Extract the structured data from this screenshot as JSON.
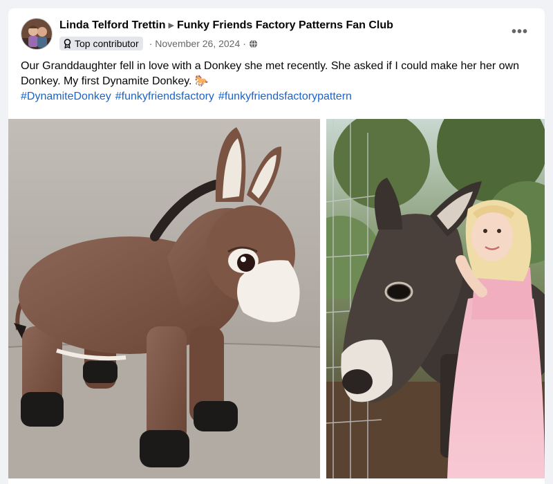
{
  "post": {
    "author": "Linda Telford Trettin",
    "group": "Funky Friends Factory Patterns Fan Club",
    "badge": "Top contributor",
    "date": "November 26, 2024",
    "more": "•••",
    "text": "Our Granddaughter fell in love with a Donkey she met recently. She asked if I could make her her own Donkey. My first Dynamite Donkey. 🐎",
    "hashtags": [
      "#DynamiteDonkey",
      "#funkyfriendsfactory",
      "#funkyfriendsfactorypattern"
    ]
  },
  "icons": {
    "badge_icon": "award-icon",
    "privacy_icon": "globe-icon",
    "separator_icon": "triangle-right-icon",
    "menu_icon": "more-options-icon"
  },
  "colors": {
    "link": "#1b63c6",
    "secondary_text": "#65676b",
    "badge_bg": "#e4e6eb"
  }
}
